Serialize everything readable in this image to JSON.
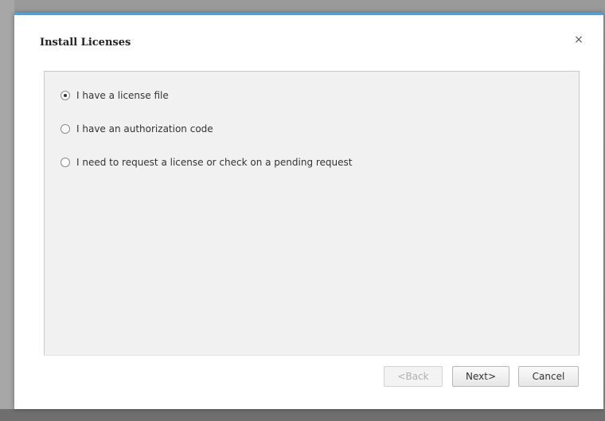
{
  "dialog": {
    "title": "Install Licenses",
    "close_glyph": "×"
  },
  "options": [
    {
      "label": "I have a license file",
      "checked": true
    },
    {
      "label": "I have an authorization code",
      "checked": false
    },
    {
      "label": "I need to request a license or check on a pending request",
      "checked": false
    }
  ],
  "buttons": {
    "back": "<Back",
    "next": "Next>",
    "cancel": "Cancel"
  },
  "colors": {
    "accent": "#4aa3df",
    "panel": "#f1f1f1"
  }
}
